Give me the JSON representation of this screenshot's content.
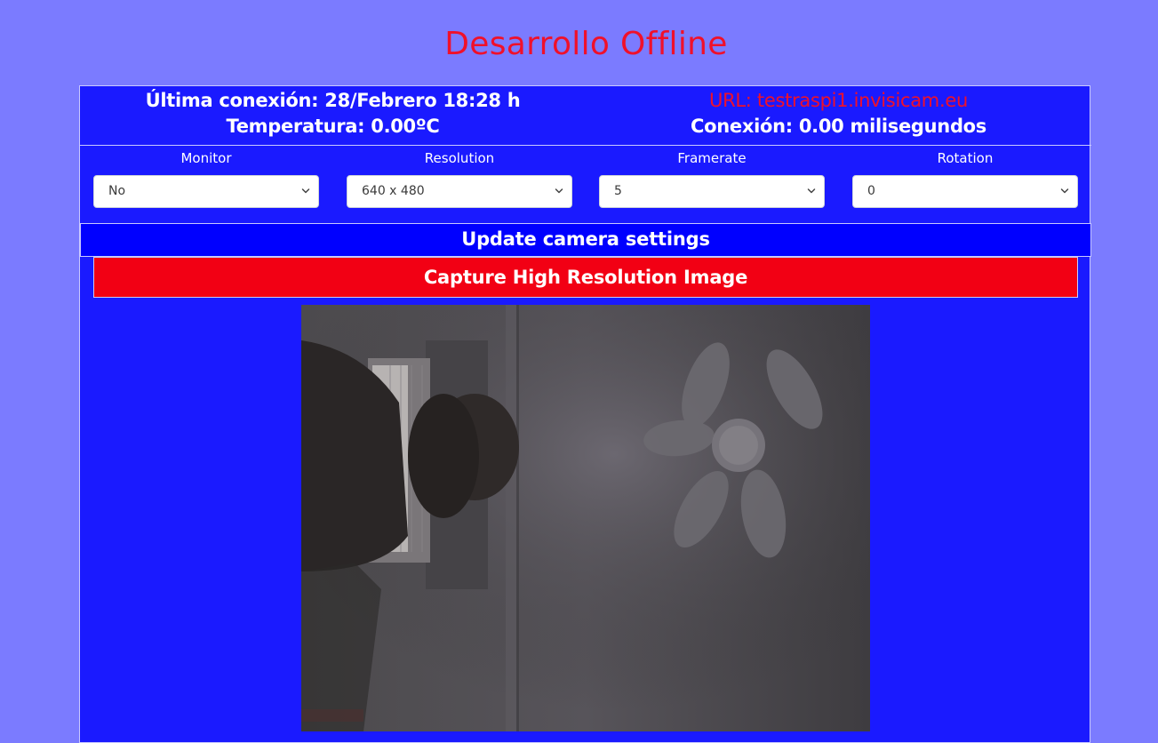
{
  "page": {
    "title": "Desarrollo Offline"
  },
  "info": {
    "last_connection": "Última conexión: 28/Febrero 18:28 h",
    "temperature": "Temperatura: 0.00ºC",
    "url": "URL: testraspi1.invisicam.eu",
    "connection_time": "Conexión: 0.00 milisegundos"
  },
  "settings": [
    {
      "label": "Monitor",
      "value": "No"
    },
    {
      "label": "Resolution",
      "value": "640 x 480"
    },
    {
      "label": "Framerate",
      "value": "5"
    },
    {
      "label": "Rotation",
      "value": "0"
    }
  ],
  "actions": {
    "update_label": "Update camera settings",
    "capture_label": "Capture High Resolution Image"
  },
  "colors": {
    "page_background": "#7b7bff",
    "panel_background": "#1a1aff",
    "update_button": "#0000ff",
    "capture_button": "#f20014",
    "title_red": "#f0102a"
  },
  "icons": {
    "select_arrow": "chevron-down-icon"
  }
}
